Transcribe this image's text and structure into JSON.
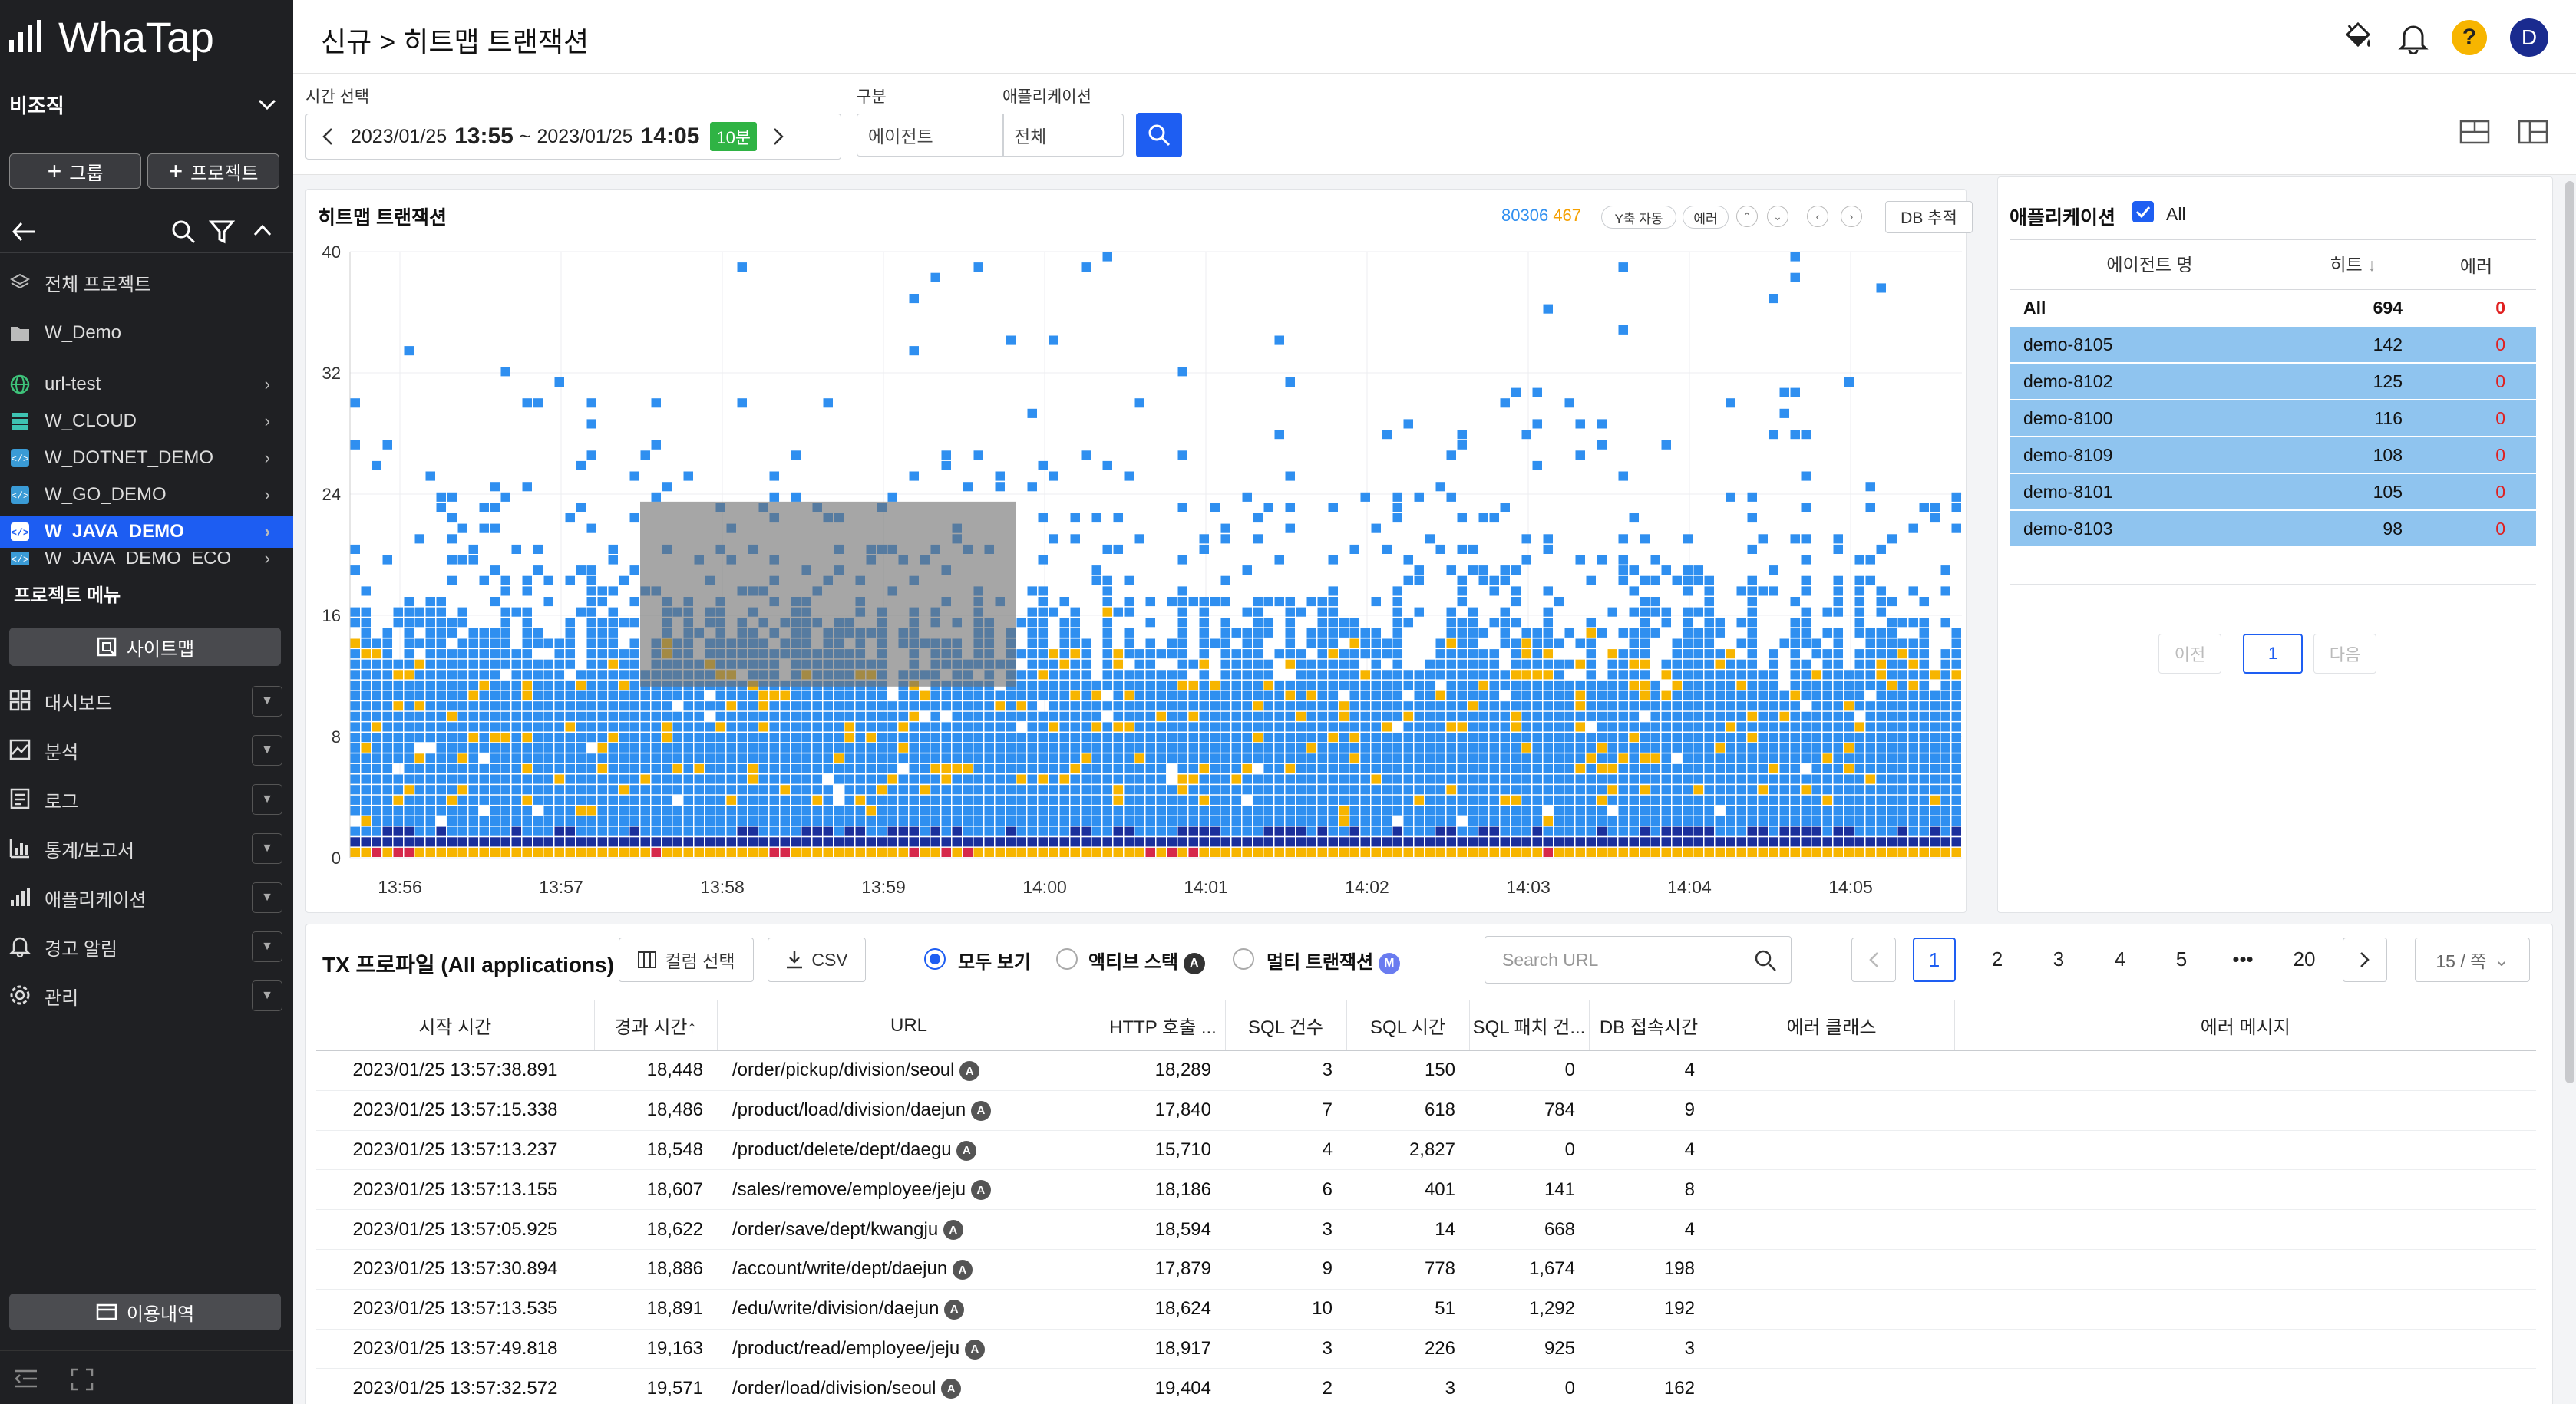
{
  "app": {
    "name": "WhaTap"
  },
  "sidebar": {
    "org": "비조직",
    "btn_group": "그룹",
    "btn_project": "프로젝트",
    "all_projects": "전체 프로젝트",
    "folder": "W_Demo",
    "projects": [
      {
        "name": "url-test",
        "icon": "globe-icon",
        "color": "#3ec37a"
      },
      {
        "name": "W_CLOUD",
        "icon": "server-icon",
        "color": "#3ec3b3"
      },
      {
        "name": "W_DOTNET_DEMO",
        "icon": "code-icon",
        "color": "#3a9bd6"
      },
      {
        "name": "W_GO_DEMO",
        "icon": "code-icon",
        "color": "#3a9bd6"
      },
      {
        "name": "W_JAVA_DEMO",
        "icon": "code-icon",
        "color": "#3a9bd6"
      },
      {
        "name": "W_JAVA_DEMO_ECO",
        "icon": "code-icon",
        "color": "#3a9bd6"
      }
    ],
    "project_menu": "프로젝트 메뉴",
    "sitemap": "사이트맵",
    "menus": [
      "대시보드",
      "분석",
      "로그",
      "통계/보고서",
      "애플리케이션",
      "경고 알림",
      "관리"
    ],
    "usage": "이용내역"
  },
  "header": {
    "breadcrumb": "신규 > 히트맵 트랜잭션",
    "avatar": "D",
    "help": "?"
  },
  "filter": {
    "time_label": "시간 선택",
    "date_from": "2023/01/25",
    "time_from": "13:55",
    "sep": "~",
    "date_to": "2023/01/25",
    "time_to": "14:05",
    "duration": "10분",
    "group_label": "구분",
    "group_value": "에이전트",
    "app_label": "애플리케이션",
    "app_value": "전체"
  },
  "heatmap": {
    "title": "히트맵 트랜잭션",
    "count_total": "80306",
    "count_error": "467",
    "btn_yaxis": "Y축 자동",
    "btn_error": "에러",
    "btn_db": "DB 추적",
    "y_ticks": [
      "40",
      "32",
      "24",
      "16",
      "8",
      "0"
    ],
    "x_ticks": [
      "13:56",
      "13:57",
      "13:58",
      "13:59",
      "14:00",
      "14:01",
      "14:02",
      "14:03",
      "14:04",
      "14:05"
    ],
    "colors": {
      "normal": "#2f8ff0",
      "slow": "#f7b500",
      "error": "#d6294b",
      "dark": "#1a2f9c",
      "select": "#8d8d8d"
    }
  },
  "apps": {
    "title": "애플리케이션",
    "all_label": "All",
    "columns": [
      "에이전트 명",
      "히트",
      "에러"
    ],
    "total": {
      "name": "All",
      "hit": "694",
      "err": "0"
    },
    "rows": [
      {
        "name": "demo-8105",
        "hit": "142",
        "err": "0"
      },
      {
        "name": "demo-8102",
        "hit": "125",
        "err": "0"
      },
      {
        "name": "demo-8100",
        "hit": "116",
        "err": "0"
      },
      {
        "name": "demo-8109",
        "hit": "108",
        "err": "0"
      },
      {
        "name": "demo-8101",
        "hit": "105",
        "err": "0"
      },
      {
        "name": "demo-8103",
        "hit": "98",
        "err": "0"
      }
    ],
    "prev": "이전",
    "page": "1",
    "next": "다음"
  },
  "tx": {
    "title": "TX 프로파일 (All applications)",
    "btn_columns": "컬럼 선택",
    "btn_csv": "CSV",
    "radio_all": "모두 보기",
    "radio_active": "액티브 스택",
    "radio_multi": "멀티 트랜잭션",
    "badge_a": "A",
    "badge_m": "M",
    "search_placeholder": "Search URL",
    "pages": [
      "1",
      "2",
      "3",
      "4",
      "5",
      "•••",
      "20"
    ],
    "page_size": "15 / 쪽",
    "columns": [
      "시작 시간",
      "경과 시간↑",
      "URL",
      "HTTP 호출 ...",
      "SQL 건수",
      "SQL 시간",
      "SQL 패치 건...",
      "DB 접속시간",
      "에러 클래스",
      "에러 메시지"
    ],
    "rows": [
      {
        "start": "2023/01/25 13:57:38.891",
        "elapsed": "18,448",
        "url": "/order/pickup/division/seoul",
        "http": "18,289",
        "sqlc": "3",
        "sqlt": "150",
        "fetch": "0",
        "db": "4"
      },
      {
        "start": "2023/01/25 13:57:15.338",
        "elapsed": "18,486",
        "url": "/product/load/division/daejun",
        "http": "17,840",
        "sqlc": "7",
        "sqlt": "618",
        "fetch": "784",
        "db": "9"
      },
      {
        "start": "2023/01/25 13:57:13.237",
        "elapsed": "18,548",
        "url": "/product/delete/dept/daegu",
        "http": "15,710",
        "sqlc": "4",
        "sqlt": "2,827",
        "fetch": "0",
        "db": "4"
      },
      {
        "start": "2023/01/25 13:57:13.155",
        "elapsed": "18,607",
        "url": "/sales/remove/employee/jeju",
        "http": "18,186",
        "sqlc": "6",
        "sqlt": "401",
        "fetch": "141",
        "db": "8"
      },
      {
        "start": "2023/01/25 13:57:05.925",
        "elapsed": "18,622",
        "url": "/order/save/dept/kwangju",
        "http": "18,594",
        "sqlc": "3",
        "sqlt": "14",
        "fetch": "668",
        "db": "4"
      },
      {
        "start": "2023/01/25 13:57:30.894",
        "elapsed": "18,886",
        "url": "/account/write/dept/daejun",
        "http": "17,879",
        "sqlc": "9",
        "sqlt": "778",
        "fetch": "1,674",
        "db": "198"
      },
      {
        "start": "2023/01/25 13:57:13.535",
        "elapsed": "18,891",
        "url": "/edu/write/division/daejun",
        "http": "18,624",
        "sqlc": "10",
        "sqlt": "51",
        "fetch": "1,292",
        "db": "192"
      },
      {
        "start": "2023/01/25 13:57:49.818",
        "elapsed": "19,163",
        "url": "/product/read/employee/jeju",
        "http": "18,917",
        "sqlc": "3",
        "sqlt": "226",
        "fetch": "925",
        "db": "3"
      },
      {
        "start": "2023/01/25 13:57:32.572",
        "elapsed": "19,571",
        "url": "/order/load/division/seoul",
        "http": "19,404",
        "sqlc": "2",
        "sqlt": "3",
        "fetch": "0",
        "db": "162"
      }
    ]
  }
}
